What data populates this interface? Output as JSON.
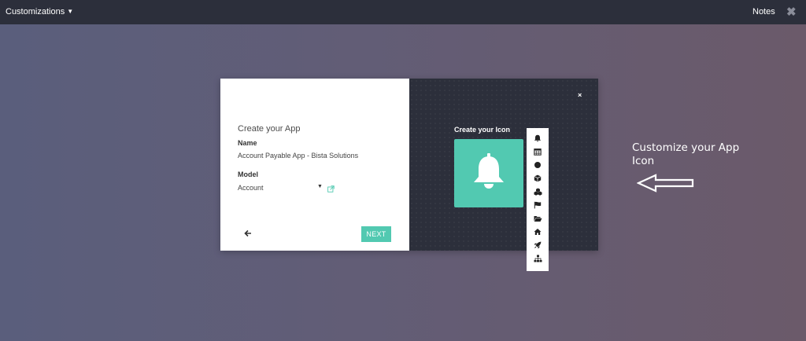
{
  "topbar": {
    "menu_label": "Customizations",
    "notes_label": "Notes",
    "close_glyph": "✖"
  },
  "left_panel": {
    "title": "Create your App",
    "name_label": "Name",
    "name_value": "Account Payable App - Bista Solutions",
    "model_label": "Model",
    "model_value": "Account",
    "back_glyph": "🡐",
    "next_label": "NEXT"
  },
  "right_panel": {
    "close_glyph": "×",
    "heading": "Create your Icon",
    "preview_icon": "bell-icon",
    "preview_color": "#52c9b1"
  },
  "icon_picker": {
    "icons": [
      "bell-icon",
      "calendar-icon",
      "circle-icon",
      "cube-icon",
      "cubes-icon",
      "flag-icon",
      "folder-open-icon",
      "home-icon",
      "rocket-icon",
      "sitemap-icon"
    ]
  },
  "annotation": {
    "text_line1": "Customize your App",
    "text_line2": "Icon"
  },
  "colors": {
    "accent": "#52c9b1",
    "dark_panel": "#2c2f3b",
    "topbar": "#2c2f3b"
  }
}
